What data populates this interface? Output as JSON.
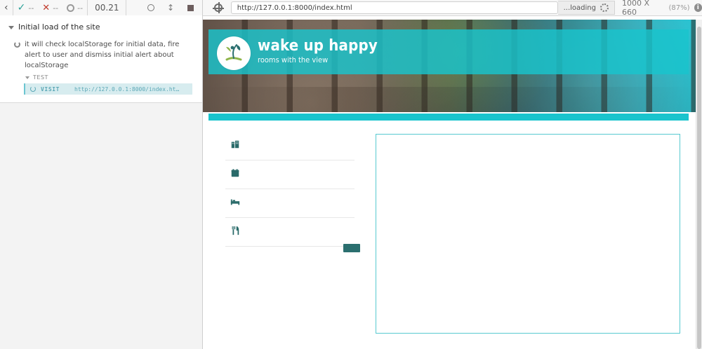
{
  "runner": {
    "passed_count": "--",
    "failed_count": "--",
    "pending_count": "--",
    "duration": "00.21",
    "colors": {
      "pass": "#2aa198",
      "fail": "#c0392b",
      "accent": "#19c4cd"
    }
  },
  "spec": {
    "suite_title": "Initial load of the site",
    "test_title": "it will check localStorage for initial data, fire alert to user and dismiss initial alert about localStorage",
    "command_group": "TEST",
    "command": {
      "name": "VISIT",
      "message": "http://127.0.0.1:8000/index.html"
    }
  },
  "browser": {
    "url": "http://127.0.0.1:8000/index.html",
    "status": "...loading",
    "viewport": "1000 X 660",
    "scale": "(87%)"
  },
  "site": {
    "brand_title": "wake up happy",
    "brand_subtitle": "rooms with the view",
    "menu_icons": [
      "building-icon",
      "calendar-icon",
      "bed-icon",
      "utensils-icon"
    ]
  }
}
